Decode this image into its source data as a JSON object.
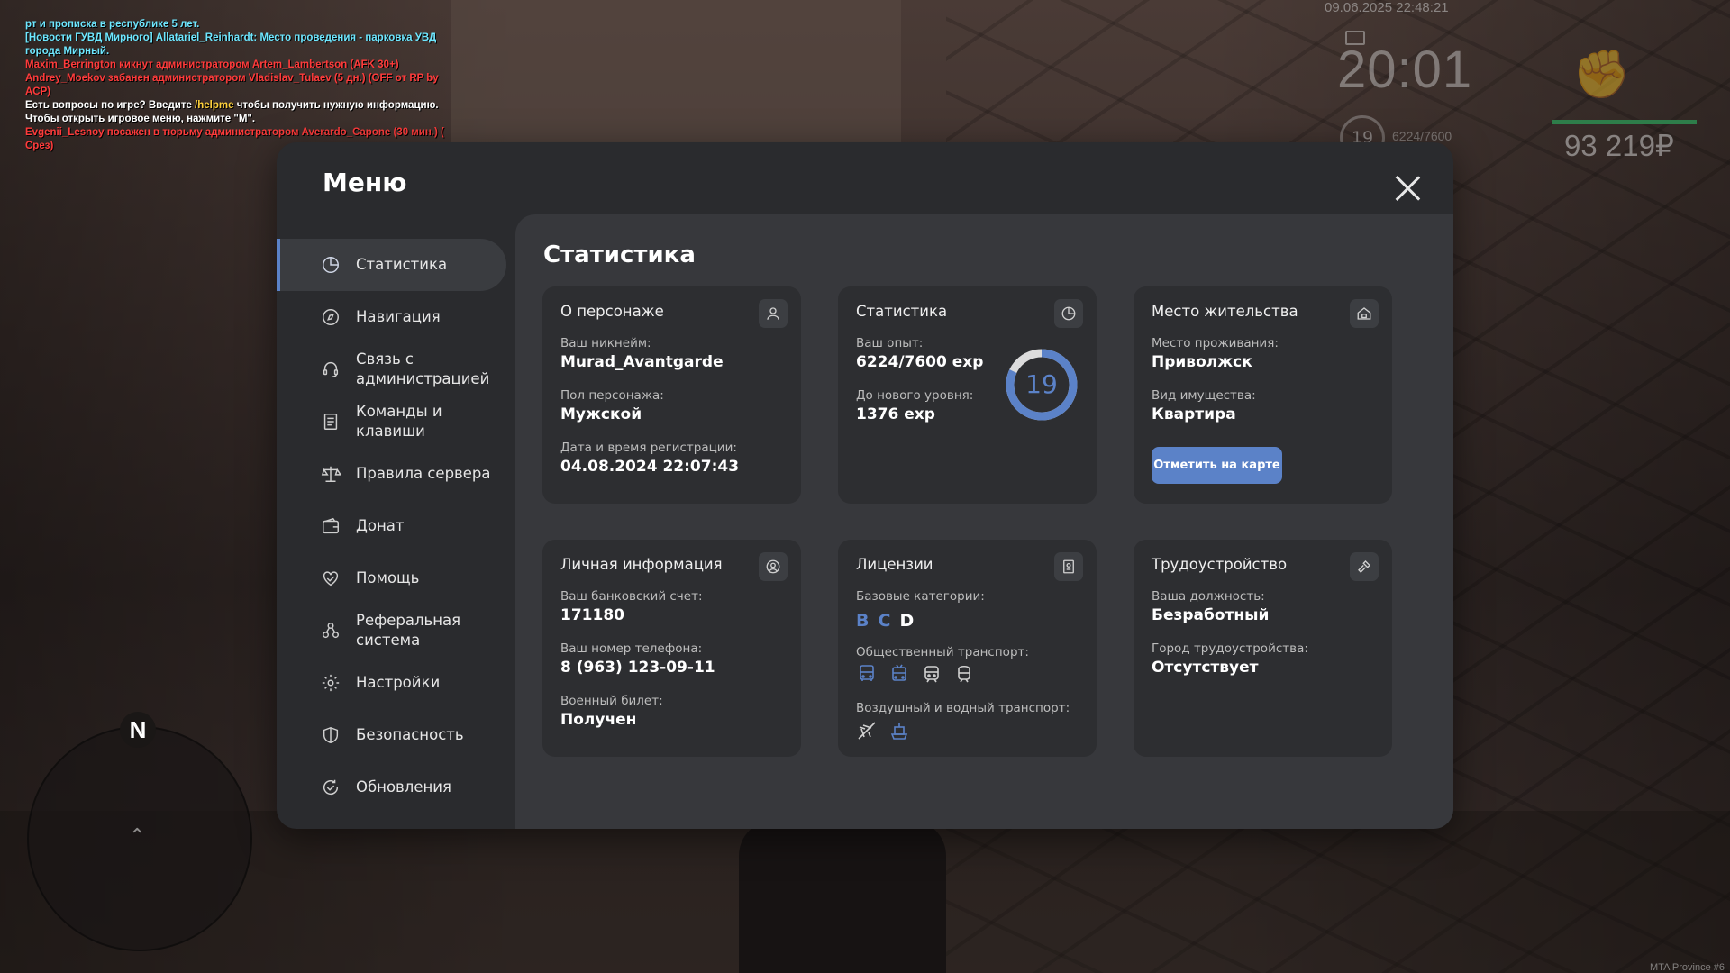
{
  "chat": [
    {
      "text": "рт и прописка в республике 5 лет.",
      "color": "cyan"
    },
    {
      "text": "[Новости ГУВД Мирного] Allatariel_Reinhardt: Место проведения - парковка УВД города Мирный.",
      "color": "cyan"
    },
    {
      "text": "Maxim_Berrington кикнут администратором Artem_Lambertson (AFK 30+)",
      "color": "red"
    },
    {
      "text": "Andrey_Moekov забанен администратором Vladislav_Tulaev (5 дн.) (OFF от RP by ACP)",
      "color": "red"
    },
    {
      "text_before": "Есть вопросы по игре? Введите ",
      "text_highlight": "/helpme",
      "text_after": " чтобы получить нужную информацию.",
      "color": "white"
    },
    {
      "text": "Чтобы открыть игровое меню, нажмите \"M\".",
      "color": "white"
    },
    {
      "text": "Evgenii_Lesnoy посажен в тюрьму администратором Averardo_Capone (30 мин.) ( Срез)",
      "color": "red"
    }
  ],
  "hud": {
    "date": "09.06.2025 22:48:21",
    "time": "20:01",
    "level": "19",
    "exp": "6224/7600",
    "money": "93 219₽",
    "brand": "MTA Province #6"
  },
  "minimap": {
    "north_label": "N"
  },
  "menu": {
    "title": "Меню",
    "nav": [
      {
        "label": "Статистика",
        "icon": "pie-chart-icon",
        "active": true
      },
      {
        "label": "Навигация",
        "icon": "compass-icon",
        "active": false
      },
      {
        "label": "Связь с администрацией",
        "icon": "headset-icon",
        "active": false
      },
      {
        "label": "Команды и клавиши",
        "icon": "document-icon",
        "active": false
      },
      {
        "label": "Правила сервера",
        "icon": "scales-icon",
        "active": false
      },
      {
        "label": "Донат",
        "icon": "wallet-icon",
        "active": false
      },
      {
        "label": "Помощь",
        "icon": "heart-hands-icon",
        "active": false
      },
      {
        "label": "Реферальная система",
        "icon": "people-icon",
        "active": false
      },
      {
        "label": "Настройки",
        "icon": "gear-icon",
        "active": false
      },
      {
        "label": "Безопасность",
        "icon": "shield-icon",
        "active": false
      },
      {
        "label": "Обновления",
        "icon": "update-icon",
        "active": false
      }
    ],
    "content_title": "Статистика",
    "cards": {
      "character": {
        "title": "О персонаже",
        "icon": "user-icon",
        "nickname_label": "Ваш никнейм:",
        "nickname": "Murad_Avantgarde",
        "gender_label": "Пол персонажа:",
        "gender": "Мужской",
        "reg_label": "Дата и время регистрации:",
        "reg": "04.08.2024 22:07:43"
      },
      "stats": {
        "title": "Статистика",
        "icon": "pie-chart-icon",
        "exp_label": "Ваш опыт:",
        "exp": "6224/7600 exp",
        "next_label": "До нового уровня:",
        "next": "1376 exp",
        "level": "19",
        "progress": 0.819
      },
      "residence": {
        "title": "Место жительства",
        "icon": "house-icon",
        "place_label": "Место проживания:",
        "place": "Приволжск",
        "property_label": "Вид имущества:",
        "property": "Квартира",
        "button": "Отметить на карте"
      },
      "personal": {
        "title": "Личная информация",
        "icon": "user-circle-icon",
        "bank_label": "Ваш банковский счет:",
        "bank": "171180",
        "phone_label": "Ваш номер телефона:",
        "phone": "8 (963) 123-09-11",
        "military_label": "Военный билет:",
        "military": "Получен"
      },
      "licenses": {
        "title": "Лицензии",
        "icon": "license-icon",
        "base_label": "Базовые категории:",
        "cat_b": "B",
        "cat_c": "C",
        "cat_d": "D",
        "public_label": "Общественный транспорт:",
        "air_label": "Воздушный и водный транспорт:"
      },
      "job": {
        "title": "Трудоустройство",
        "icon": "hammer-icon",
        "position_label": "Ваша должность:",
        "position": "Безработный",
        "city_label": "Город трудоустройства:",
        "city": "Отсутствует"
      }
    }
  },
  "colors": {
    "accent": "#5b82c8",
    "panel": "#2a2b2e",
    "content": "#37383c",
    "card": "#2d2e31"
  }
}
